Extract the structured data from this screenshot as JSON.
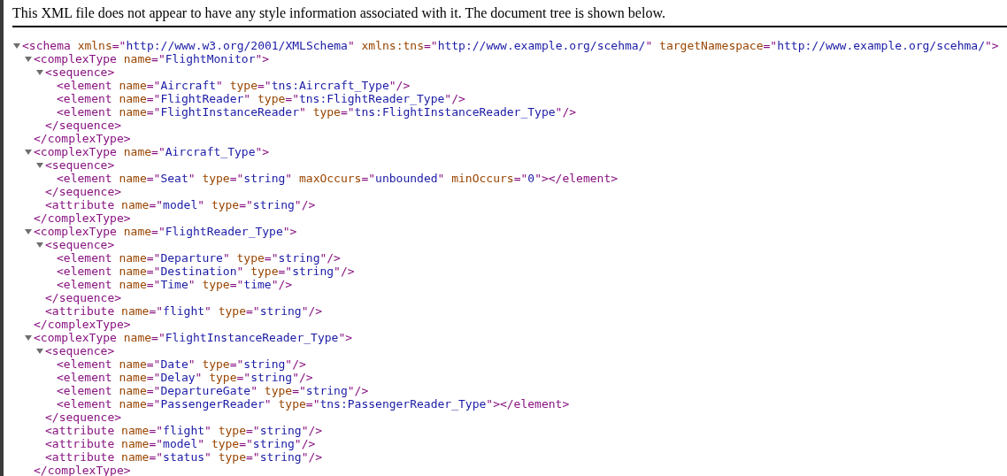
{
  "notice": "This XML file does not appear to have any style information associated with it. The document tree is shown below.",
  "tree": {
    "kind": "node",
    "expanded": true,
    "open": "<schema xmlns=\"http://www.w3.org/2001/XMLSchema\" xmlns:tns=\"http://www.example.org/scehma/\" targetNamespace=\"http://www.example.org/scehma/\">",
    "children": [
      {
        "kind": "node",
        "expanded": true,
        "open": "<complexType name=\"FlightMonitor\">",
        "close": "</complexType>",
        "children": [
          {
            "kind": "node",
            "expanded": true,
            "open": "<sequence>",
            "close": "</sequence>",
            "children": [
              {
                "kind": "leaf",
                "text": "<element name=\"Aircraft\" type=\"tns:Aircraft_Type\"/>"
              },
              {
                "kind": "leaf",
                "text": "<element name=\"FlightReader\" type=\"tns:FlightReader_Type\"/>"
              },
              {
                "kind": "leaf",
                "text": "<element name=\"FlightInstanceReader\" type=\"tns:FlightInstanceReader_Type\"/>"
              }
            ]
          }
        ]
      },
      {
        "kind": "node",
        "expanded": true,
        "open": "<complexType name=\"Aircraft_Type\">",
        "close": "</complexType>",
        "children": [
          {
            "kind": "node",
            "expanded": true,
            "open": "<sequence>",
            "close": "</sequence>",
            "children": [
              {
                "kind": "leaf",
                "text": "<element name=\"Seat\" type=\"string\" maxOccurs=\"unbounded\" minOccurs=\"0\"></element>"
              }
            ]
          },
          {
            "kind": "leaf",
            "text": "<attribute name=\"model\" type=\"string\"/>"
          }
        ]
      },
      {
        "kind": "node",
        "expanded": true,
        "open": "<complexType name=\"FlightReader_Type\">",
        "close": "</complexType>",
        "children": [
          {
            "kind": "node",
            "expanded": true,
            "open": "<sequence>",
            "close": "</sequence>",
            "children": [
              {
                "kind": "leaf",
                "text": "<element name=\"Departure\" type=\"string\"/>"
              },
              {
                "kind": "leaf",
                "text": "<element name=\"Destination\" type=\"string\"/>"
              },
              {
                "kind": "leaf",
                "text": "<element name=\"Time\" type=\"time\"/>"
              }
            ]
          },
          {
            "kind": "leaf",
            "text": "<attribute name=\"flight\" type=\"string\"/>"
          }
        ]
      },
      {
        "kind": "node",
        "expanded": true,
        "open": "<complexType name=\"FlightInstanceReader_Type\">",
        "close": "</complexType>",
        "children": [
          {
            "kind": "node",
            "expanded": true,
            "open": "<sequence>",
            "close": "</sequence>",
            "children": [
              {
                "kind": "leaf",
                "text": "<element name=\"Date\" type=\"string\"/>"
              },
              {
                "kind": "leaf",
                "text": "<element name=\"Delay\" type=\"string\"/>"
              },
              {
                "kind": "leaf",
                "text": "<element name=\"DepartureGate\" type=\"string\"/>"
              },
              {
                "kind": "leaf",
                "text": "<element name=\"PassengerReader\" type=\"tns:PassengerReader_Type\"></element>"
              }
            ]
          },
          {
            "kind": "leaf",
            "text": "<attribute name=\"flight\" type=\"string\"/>"
          },
          {
            "kind": "leaf",
            "text": "<attribute name=\"model\" type=\"string\"/>"
          },
          {
            "kind": "leaf",
            "text": "<attribute name=\"status\" type=\"string\"/>"
          }
        ]
      }
    ]
  }
}
